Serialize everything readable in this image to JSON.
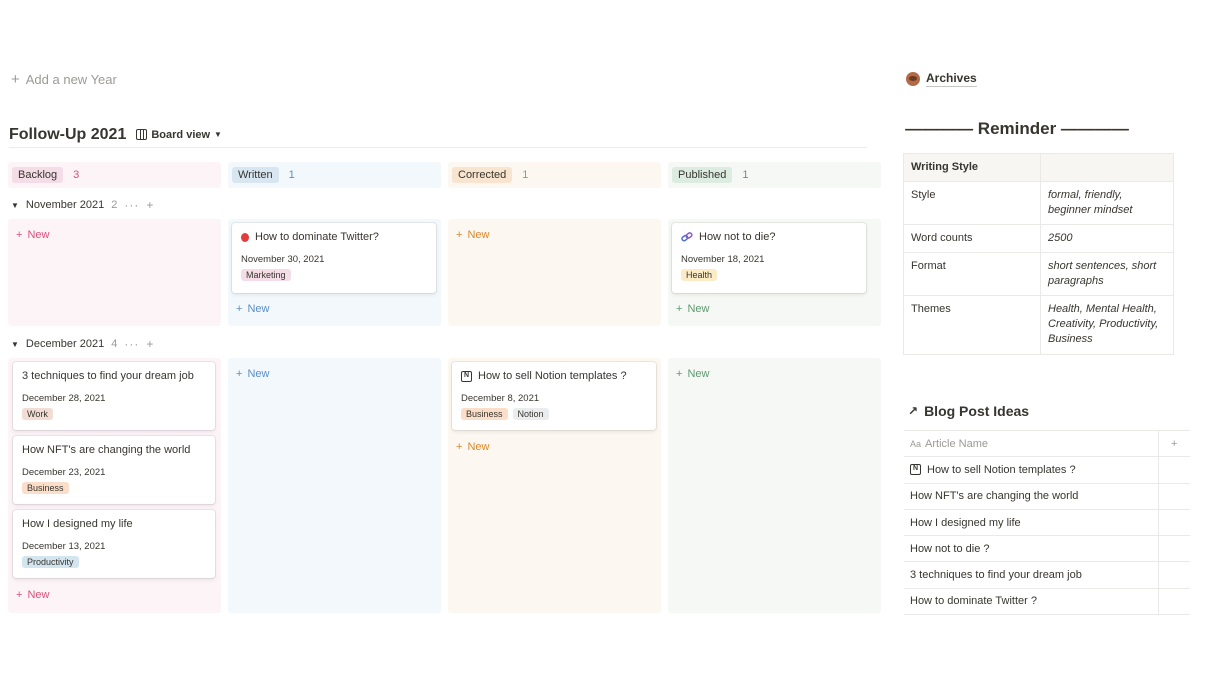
{
  "add_year": {
    "label": "Add a new Year"
  },
  "board": {
    "title": "Follow-Up 2021",
    "view_label": "Board view"
  },
  "columns": [
    {
      "label": "Backlog",
      "count": "3",
      "pill_color": "#f5dde7",
      "count_color": "#d9527d",
      "head_bg": "#fdf4f8",
      "body_bg": "#fdf4f8",
      "new_color": "#d9527d"
    },
    {
      "label": "Written",
      "count": "1",
      "pill_color": "#d8e6f2",
      "count_color": "#5b8fc4",
      "head_bg": "#f3f8fc",
      "body_bg": "#f3f8fc",
      "new_color": "#5b8fc4"
    },
    {
      "label": "Corrected",
      "count": "1",
      "pill_color": "#f8e4cf",
      "count_color": "#d9892e",
      "head_bg": "#fcf8f1",
      "body_bg": "#fcf8f1",
      "new_color": "#d9892e"
    },
    {
      "label": "Published",
      "count": "1",
      "pill_color": "#dcece0",
      "count_color": "#5e9a70",
      "head_bg": "#f6f8f5",
      "body_bg": "#f6f8f5",
      "new_color": "#5e9a70"
    }
  ],
  "groups": [
    {
      "label": "November 2021",
      "count": "2"
    },
    {
      "label": "December 2021",
      "count": "4"
    }
  ],
  "new_label": "New",
  "cards": {
    "twitter": {
      "title": "How to dominate Twitter?",
      "date": "November 30, 2021",
      "tag": "Marketing",
      "tag_color": "#f5dde7",
      "icon": "balloon-icon"
    },
    "die": {
      "title": "How not to die?",
      "date": "November 18, 2021",
      "tag": "Health",
      "tag_color": "#fbecc6",
      "icon": "chain-link-icon"
    },
    "dream_job": {
      "title": "3 techniques to find your dream job",
      "date": "December 28, 2021",
      "tag": "Work",
      "tag_color": "#f1ddd3"
    },
    "nft": {
      "title": "How NFT's are changing the world",
      "date": "December 23, 2021",
      "tag": "Business",
      "tag_color": "#fadec9"
    },
    "designed": {
      "title": "How I designed my life",
      "date": "December 13, 2021",
      "tag": "Productivity",
      "tag_color": "#d3e5ef"
    },
    "notion": {
      "title": "How to sell Notion templates ?",
      "date": "December 8, 2021",
      "tags": [
        "Business",
        "Notion"
      ],
      "tag_colors": [
        "#fadec9",
        "#ebeced"
      ],
      "icon": "notion-icon"
    }
  },
  "archives": {
    "label": "Archives"
  },
  "reminder": {
    "title": "———— Reminder ————",
    "header": "Writing Style",
    "rows": [
      {
        "key": "Style",
        "value": "formal, friendly, beginner mindset"
      },
      {
        "key": "Word counts",
        "value": "2500"
      },
      {
        "key": "Format",
        "value": "short sentences, short paragraphs"
      },
      {
        "key": "Themes",
        "value": "Health, Mental Health, Creativity, Productivity, Business"
      }
    ]
  },
  "blog_ideas": {
    "title": "Blog Post Ideas",
    "column_header": "Article Name",
    "items": [
      "How to sell Notion templates ?",
      "How NFT's are changing the world",
      "How I designed my life",
      "How not to die ?",
      "3 techniques to find your dream job",
      "How to dominate Twitter ?"
    ]
  }
}
